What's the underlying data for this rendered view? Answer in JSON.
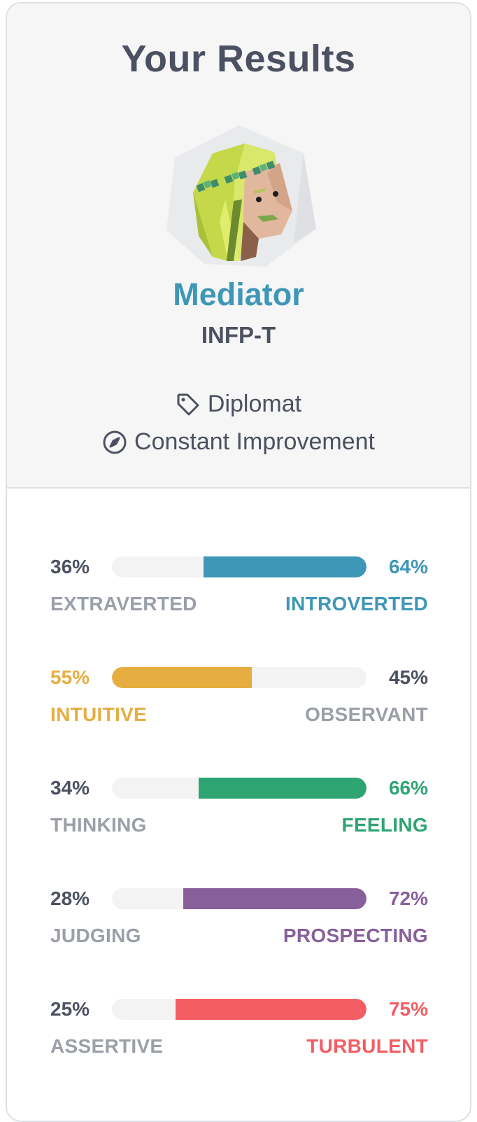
{
  "header": {
    "title": "Your Results",
    "type_name": "Mediator",
    "type_code": "INFP-T",
    "role": {
      "icon": "tag-icon",
      "label": "Diplomat"
    },
    "strategy": {
      "icon": "compass-icon",
      "label": "Constant Improvement"
    }
  },
  "traits": [
    {
      "left_pct": "36%",
      "left_label": "EXTRAVERTED",
      "right_pct": "64%",
      "right_label": "INTROVERTED",
      "dominant": "right",
      "value": 0.64,
      "color": "#3e97b6"
    },
    {
      "left_pct": "55%",
      "left_label": "INTUITIVE",
      "right_pct": "45%",
      "right_label": "OBSERVANT",
      "dominant": "left",
      "value": 0.55,
      "color": "#e6ae41"
    },
    {
      "left_pct": "34%",
      "left_label": "THINKING",
      "right_pct": "66%",
      "right_label": "FEELING",
      "dominant": "right",
      "value": 0.66,
      "color": "#2fa473"
    },
    {
      "left_pct": "28%",
      "left_label": "JUDGING",
      "right_pct": "72%",
      "right_label": "PROSPECTING",
      "dominant": "right",
      "value": 0.72,
      "color": "#87609b"
    },
    {
      "left_pct": "25%",
      "left_label": "ASSERTIVE",
      "right_pct": "75%",
      "right_label": "TURBULENT",
      "dominant": "right",
      "value": 0.75,
      "color": "#f25e63"
    }
  ]
}
